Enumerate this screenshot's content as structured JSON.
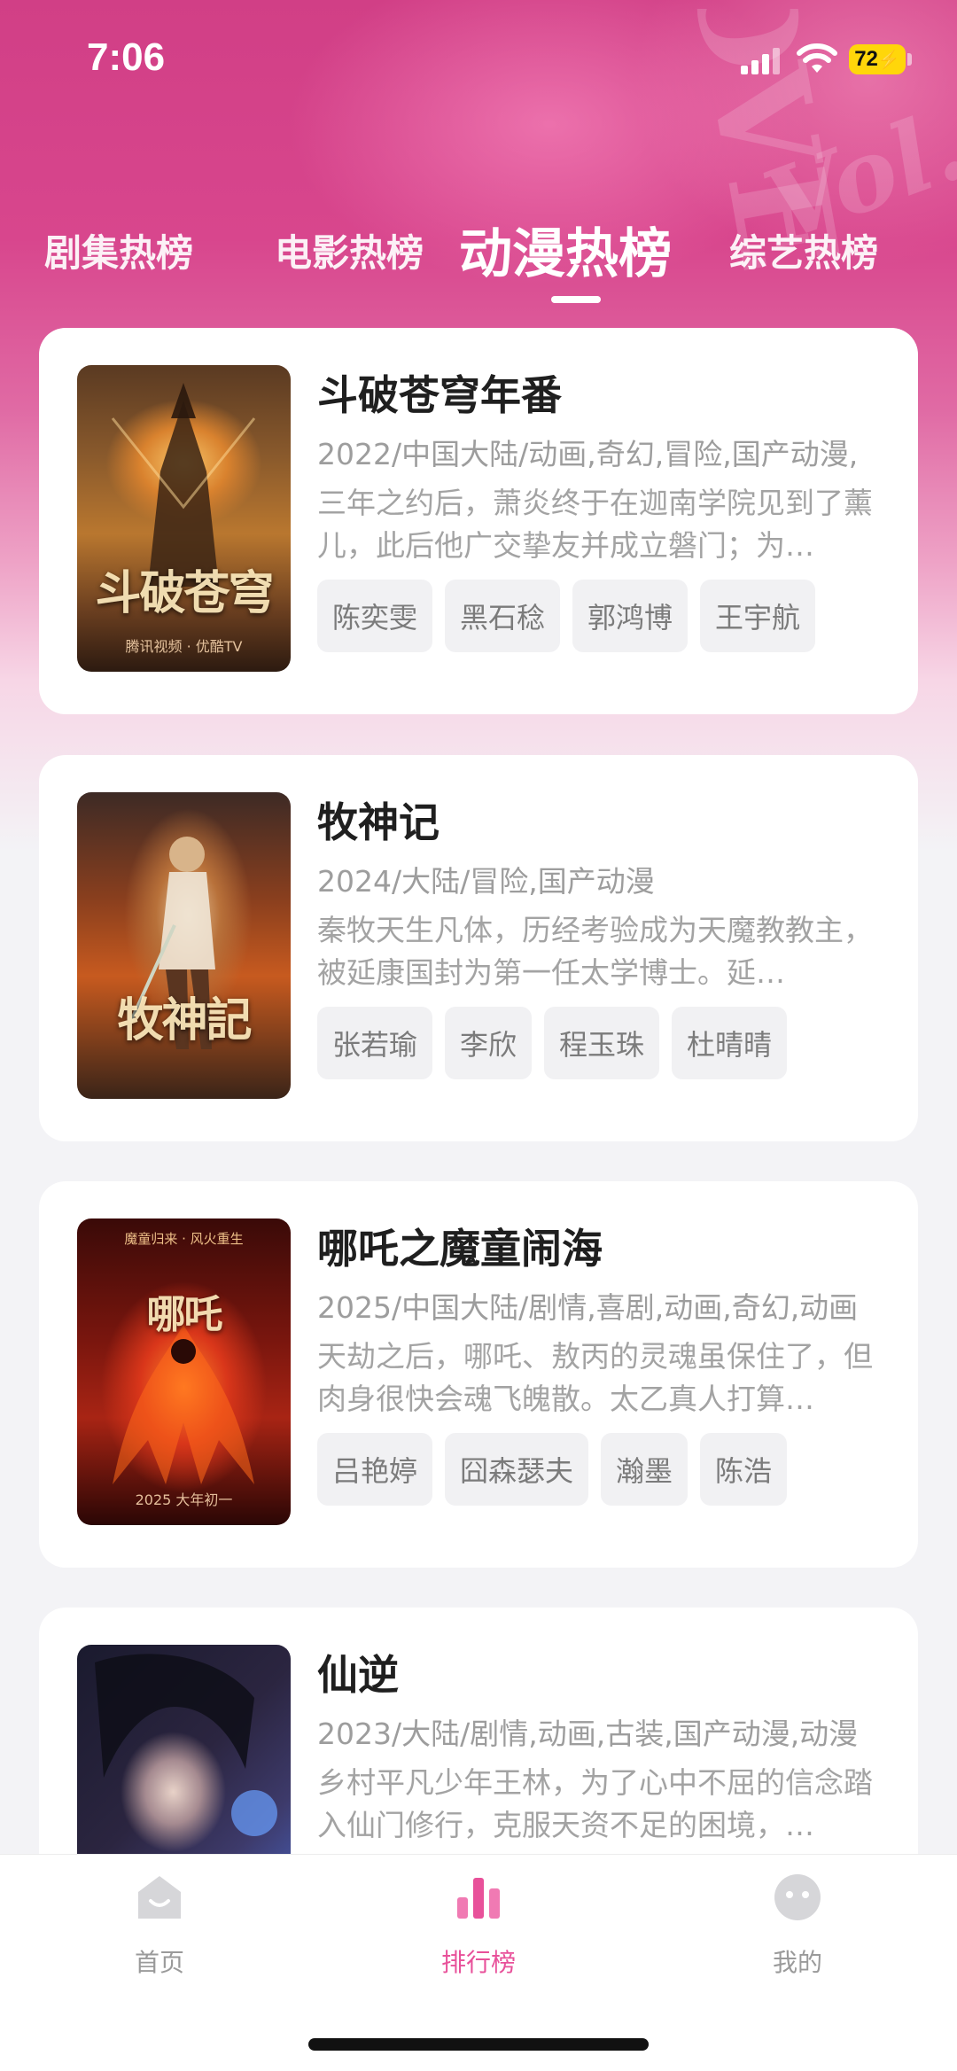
{
  "status_bar": {
    "time": "7:06",
    "battery": "72"
  },
  "tabs": [
    {
      "label": "剧集热榜",
      "active": false
    },
    {
      "label": "电影热榜",
      "active": false
    },
    {
      "label": "动漫热榜",
      "active": true
    },
    {
      "label": "综艺热榜",
      "active": false
    }
  ],
  "items": [
    {
      "title": "斗破苍穹年番",
      "meta": "2022/中国大陆/动画,奇幻,冒险,国产动漫,",
      "desc": "三年之约后，萧炎终于在迦南学院见到了薰儿，此后他广交挚友并成立磐门；为…",
      "actors": [
        "陈奕雯",
        "黑石稔",
        "郭鸿博",
        "王宇航"
      ],
      "poster_text": "斗破苍穹",
      "poster_sub": "腾讯视频 · 优酷TV"
    },
    {
      "title": "牧神记",
      "meta": "2024/大陆/冒险,国产动漫",
      "desc": "秦牧天生凡体，历经考验成为天魔教教主，被延康国封为第一任太学博士。延…",
      "actors": [
        "张若瑜",
        "李欣",
        "程玉珠",
        "杜晴晴"
      ],
      "poster_text": "牧神記",
      "poster_sub": ""
    },
    {
      "title": "哪吒之魔童闹海",
      "meta": "2025/中国大陆/剧情,喜剧,动画,奇幻,动画",
      "desc": "天劫之后，哪吒、敖丙的灵魂虽保住了，但肉身很快会魂飞魄散。太乙真人打算…",
      "actors": [
        "吕艳婷",
        "囧森瑟夫",
        "瀚墨",
        "陈浩"
      ],
      "poster_text": "哪吒",
      "poster_sub": "2025 大年初一",
      "poster_top": "魔童归来 · 风火重生"
    },
    {
      "title": "仙逆",
      "meta": "2023/大陆/剧情,动画,古装,国产动漫,动漫",
      "desc": "乡村平凡少年王林，为了心中不屈的信念踏入仙门修行，克服天资不足的困境，…",
      "actors": [],
      "poster_text": "",
      "poster_sub": ""
    }
  ],
  "bottom_nav": [
    {
      "label": "首页",
      "icon": "home-icon",
      "active": false
    },
    {
      "label": "排行榜",
      "icon": "ranking-icon",
      "active": true
    },
    {
      "label": "我的",
      "icon": "profile-icon",
      "active": false
    }
  ],
  "colors": {
    "accent": "#e8519a",
    "hero": "#d13f86"
  }
}
